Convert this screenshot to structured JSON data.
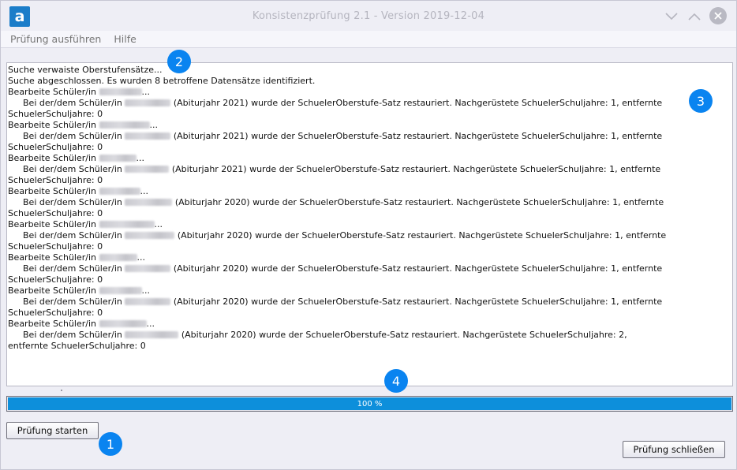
{
  "window": {
    "title": "Konsistenzprüfung 2.1 - Version 2019-12-04",
    "app_icon_letter": "a",
    "accent_color": "#1b7dc9"
  },
  "menu": {
    "items": [
      "Prüfung ausführen",
      "Hilfe"
    ]
  },
  "log": {
    "lines": [
      {
        "text": "Suche verwaiste Oberstufensätze..."
      },
      {
        "text": "Suche abgeschlossen. Es wurden 8 betroffene Datensätze identifiziert."
      },
      {
        "text": "Bearbeite Schüler/in",
        "suffix": "..."
      },
      {
        "indent": true,
        "prefix": "Bei der/dem Schüler/in",
        "text": "(Abiturjahr 2021) wurde der SchuelerOberstufe-Satz restauriert. Nachgerüstete SchuelerSchuljahre: 1, entfernte"
      },
      {
        "text": "SchuelerSchuljahre: 0"
      },
      {
        "text": "Bearbeite Schüler/in",
        "suffix": "..."
      },
      {
        "indent": true,
        "prefix": "Bei der/dem Schüler/in",
        "text": "(Abiturjahr 2021) wurde der SchuelerOberstufe-Satz restauriert. Nachgerüstete SchuelerSchuljahre: 1, entfernte"
      },
      {
        "text": "SchuelerSchuljahre: 0"
      },
      {
        "text": "Bearbeite Schüler/in",
        "suffix": "..."
      },
      {
        "indent": true,
        "prefix": "Bei der/dem Schüler/in",
        "text": "(Abiturjahr 2021) wurde der SchuelerOberstufe-Satz restauriert. Nachgerüstete SchuelerSchuljahre: 1, entfernte"
      },
      {
        "text": "SchuelerSchuljahre: 0"
      },
      {
        "text": "Bearbeite Schüler/in",
        "suffix": "..."
      },
      {
        "indent": true,
        "prefix": "Bei der/dem Schüler/in",
        "text": "(Abiturjahr 2020) wurde der SchuelerOberstufe-Satz restauriert. Nachgerüstete SchuelerSchuljahre: 1, entfernte"
      },
      {
        "text": "SchuelerSchuljahre: 0"
      },
      {
        "text": "Bearbeite Schüler/in",
        "suffix": "..."
      },
      {
        "indent": true,
        "prefix": "Bei der/dem Schüler/in",
        "text": "(Abiturjahr 2020) wurde der SchuelerOberstufe-Satz restauriert. Nachgerüstete SchuelerSchuljahre: 1, entfernte"
      },
      {
        "text": "SchuelerSchuljahre: 0"
      },
      {
        "text": "Bearbeite Schüler/in",
        "suffix": "..."
      },
      {
        "indent": true,
        "prefix": "Bei der/dem Schüler/in",
        "text": "(Abiturjahr 2020) wurde der SchuelerOberstufe-Satz restauriert. Nachgerüstete SchuelerSchuljahre: 1, entfernte"
      },
      {
        "text": "SchuelerSchuljahre: 0"
      },
      {
        "text": "Bearbeite Schüler/in",
        "suffix": "..."
      },
      {
        "indent": true,
        "prefix": "Bei der/dem Schüler/in",
        "text": "(Abiturjahr 2020) wurde der SchuelerOberstufe-Satz restauriert. Nachgerüstete SchuelerSchuljahre: 1, entfernte"
      },
      {
        "text": "SchuelerSchuljahre: 0"
      },
      {
        "text": "Bearbeite Schüler/in",
        "suffix": "..."
      },
      {
        "indent": true,
        "prefix": "Bei der/dem Schüler/in",
        "text": "(Abiturjahr 2020) wurde der SchuelerOberstufe-Satz restauriert. Nachgerüstete SchuelerSchuljahre: 2,"
      },
      {
        "text": "entfernte SchuelerSchuljahre: 0"
      }
    ]
  },
  "progress": {
    "value_percent": 100,
    "label": "100 %",
    "fill_color": "#0d8fdb"
  },
  "buttons": {
    "start": "Prüfung starten",
    "close": "Prüfung schließen"
  },
  "markers": [
    "1",
    "2",
    "3",
    "4"
  ],
  "marker_color": "#0a84f0"
}
